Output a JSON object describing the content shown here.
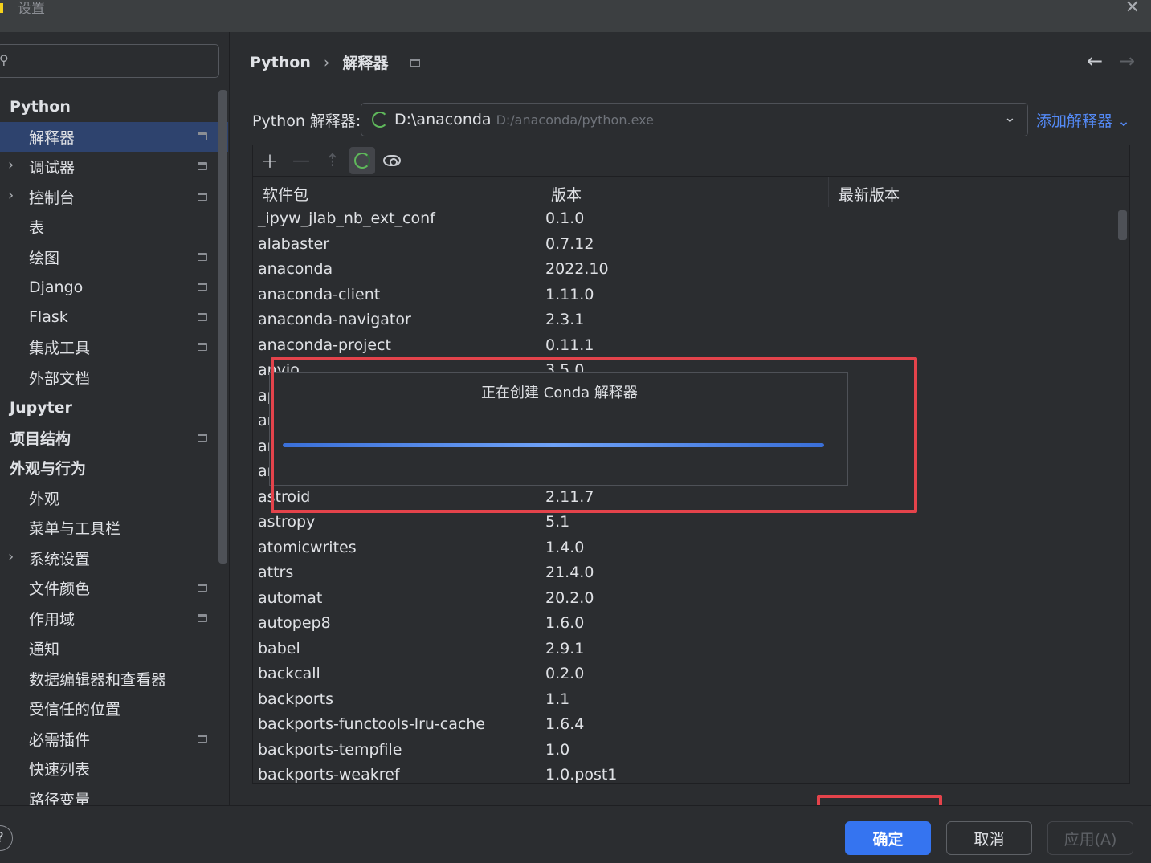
{
  "window": {
    "title": "设置"
  },
  "search": {
    "placeholder": ""
  },
  "sidebar": {
    "items": [
      {
        "label": "Python",
        "kind": "group"
      },
      {
        "label": "解释器",
        "kind": "child",
        "pin": true,
        "selected": true
      },
      {
        "label": "调试器",
        "kind": "child",
        "pin": true,
        "expandable": true
      },
      {
        "label": "控制台",
        "kind": "child",
        "pin": true,
        "expandable": true
      },
      {
        "label": "表",
        "kind": "child"
      },
      {
        "label": "绘图",
        "kind": "child",
        "pin": true
      },
      {
        "label": "Django",
        "kind": "child",
        "pin": true
      },
      {
        "label": "Flask",
        "kind": "child",
        "pin": true
      },
      {
        "label": "集成工具",
        "kind": "child",
        "pin": true
      },
      {
        "label": "外部文档",
        "kind": "child"
      },
      {
        "label": "Jupyter",
        "kind": "group"
      },
      {
        "label": "项目结构",
        "kind": "group",
        "pin": true
      },
      {
        "label": "外观与行为",
        "kind": "group"
      },
      {
        "label": "外观",
        "kind": "child"
      },
      {
        "label": "菜单与工具栏",
        "kind": "child"
      },
      {
        "label": "系统设置",
        "kind": "child",
        "expandable": true
      },
      {
        "label": "文件颜色",
        "kind": "child",
        "pin": true
      },
      {
        "label": "作用域",
        "kind": "child",
        "pin": true
      },
      {
        "label": "通知",
        "kind": "child"
      },
      {
        "label": "数据编辑器和查看器",
        "kind": "child"
      },
      {
        "label": "受信任的位置",
        "kind": "child"
      },
      {
        "label": "必需插件",
        "kind": "child",
        "pin": true
      },
      {
        "label": "快速列表",
        "kind": "child"
      },
      {
        "label": "路径变量",
        "kind": "child"
      }
    ]
  },
  "breadcrumb": {
    "parent": "Python",
    "separator": "›",
    "current": "解释器"
  },
  "interpreter": {
    "label": "Python 解释器:",
    "name": "D:\\anaconda",
    "path": "D:/anaconda/python.exe",
    "add_label": "添加解释器"
  },
  "table": {
    "columns": [
      "软件包",
      "版本",
      "最新版本"
    ],
    "rows": [
      {
        "name": "_ipyw_jlab_nb_ext_conf",
        "version": "0.1.0"
      },
      {
        "name": "alabaster",
        "version": "0.7.12"
      },
      {
        "name": "anaconda",
        "version": "2022.10"
      },
      {
        "name": "anaconda-client",
        "version": "1.11.0"
      },
      {
        "name": "anaconda-navigator",
        "version": "2.3.1"
      },
      {
        "name": "anaconda-project",
        "version": "0.11.1"
      },
      {
        "name": "anyio",
        "version": "3.5.0"
      },
      {
        "name": "ap",
        "version": ""
      },
      {
        "name": "ar",
        "version": ""
      },
      {
        "name": "ar",
        "version": ""
      },
      {
        "name": "ar",
        "version": ""
      },
      {
        "name": "astroid",
        "version": "2.11.7"
      },
      {
        "name": "astropy",
        "version": "5.1"
      },
      {
        "name": "atomicwrites",
        "version": "1.4.0"
      },
      {
        "name": "attrs",
        "version": "21.4.0"
      },
      {
        "name": "automat",
        "version": "20.2.0"
      },
      {
        "name": "autopep8",
        "version": "1.6.0"
      },
      {
        "name": "babel",
        "version": "2.9.1"
      },
      {
        "name": "backcall",
        "version": "0.2.0"
      },
      {
        "name": "backports",
        "version": "1.1"
      },
      {
        "name": "backports-functools-lru-cache",
        "version": "1.6.4"
      },
      {
        "name": "backports-tempfile",
        "version": "1.0"
      },
      {
        "name": "backports-weakref",
        "version": "1.0.post1"
      }
    ]
  },
  "progress": {
    "title": "正在创建 Conda 解释器",
    "fraction": 1.0
  },
  "footer": {
    "ok": "确定",
    "cancel": "取消",
    "apply": "应用(A)",
    "help": "?"
  },
  "colors": {
    "accent": "#3574f0",
    "link": "#548af7",
    "highlight": "#e4434b",
    "selected": "#2e436e"
  }
}
